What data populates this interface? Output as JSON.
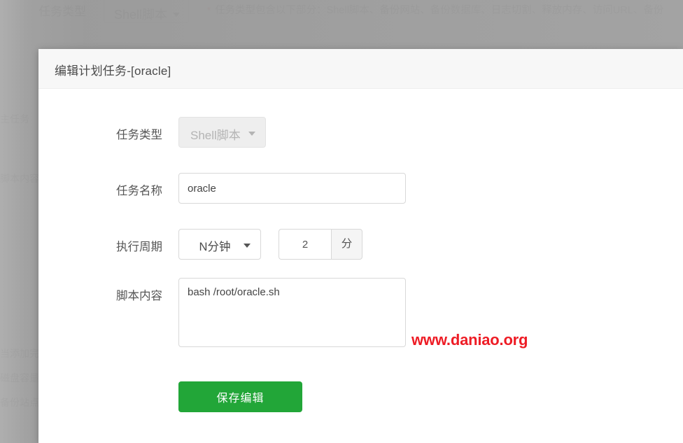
{
  "background": {
    "toolbar": {
      "label": "任务类型",
      "select_value": "Shell脚本",
      "caret_icon": "chevron-down-icon",
      "hint_star": "*",
      "hint_text": "任务类型包含以下部分：Shell脚本、备份网站、备份数据库、日志切割、释放内存、访问URL、备份"
    },
    "left_text": {
      "line1": "主任务",
      "line2": "脚本内容",
      "line3": "当添加完成的计划任务",
      "line4": "磁盘容量不足时会提示",
      "line5": "备份站点时请注意空间"
    }
  },
  "modal": {
    "title": "编辑计划任务-[oracle]",
    "fields": {
      "task_type": {
        "label": "任务类型",
        "value": "Shell脚本",
        "disabled": true,
        "caret_icon": "chevron-down-icon"
      },
      "task_name": {
        "label": "任务名称",
        "value": "oracle",
        "placeholder": "任务名称"
      },
      "period": {
        "label": "执行周期",
        "cycle_value": "N分钟",
        "caret_icon": "chevron-down-icon",
        "amount_value": "2",
        "amount_placeholder": "",
        "unit_addon": "分"
      },
      "script": {
        "label": "脚本内容",
        "value": "bash /root/oracle.sh",
        "placeholder": "脚本内容"
      }
    },
    "submit_label": "保存编辑"
  },
  "watermark": {
    "text": "www.daniao.org",
    "color": "#ee1c25"
  },
  "colors": {
    "primary_button": "#22a638",
    "backdrop": "#9e9e9e",
    "modal_header": "#f7f7f7",
    "border": "#d8d8d8"
  }
}
